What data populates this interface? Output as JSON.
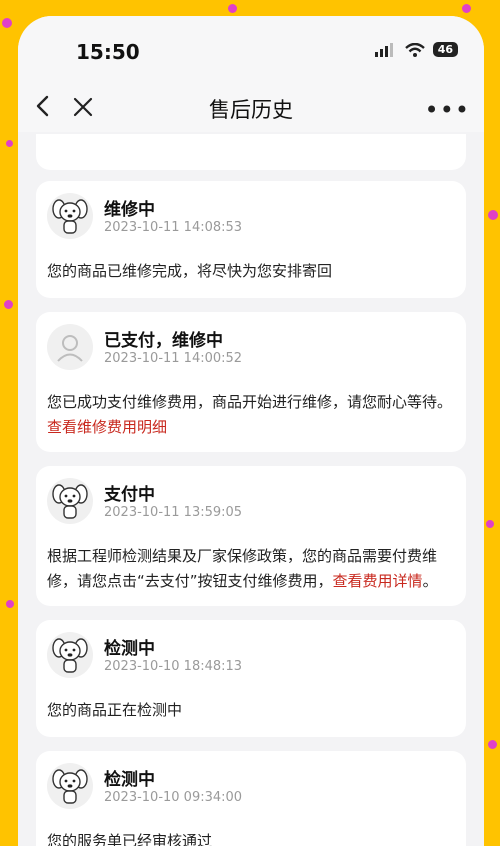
{
  "status_bar": {
    "time": "15:50",
    "battery": "46"
  },
  "nav": {
    "title": "售后历史"
  },
  "icons": {
    "back": "chevron-left-icon",
    "close": "close-icon",
    "more": "more-icon"
  },
  "colors": {
    "background": "#FFC300",
    "accent_dot": "#E040C8",
    "link": "#C8281E"
  },
  "records": [
    {
      "status": "维修中",
      "time": "2023-10-11 14:08:53",
      "avatar": "joy-mascot-icon",
      "text": "您的商品已维修完成，将尽快为您安排寄回"
    },
    {
      "status": "已支付，维修中",
      "time": "2023-10-11 14:00:52",
      "avatar": "user-placeholder-icon",
      "text": "您已成功支付维修费用，商品开始进行维修，请您耐心等待。",
      "link": "查看维修费用明细"
    },
    {
      "status": "支付中",
      "time": "2023-10-11 13:59:05",
      "avatar": "joy-mascot-icon",
      "text": "根据工程师检测结果及厂家保修政策，您的商品需要付费维修，请您点击“去支付”按钮支付维修费用，",
      "link": "查看费用详情",
      "text_after": "。"
    },
    {
      "status": "检测中",
      "time": "2023-10-10 18:48:13",
      "avatar": "joy-mascot-icon",
      "text": "您的商品正在检测中"
    },
    {
      "status": "检测中",
      "time": "2023-10-10 09:34:00",
      "avatar": "joy-mascot-icon",
      "text": "您的服务单已经审核通过"
    }
  ]
}
